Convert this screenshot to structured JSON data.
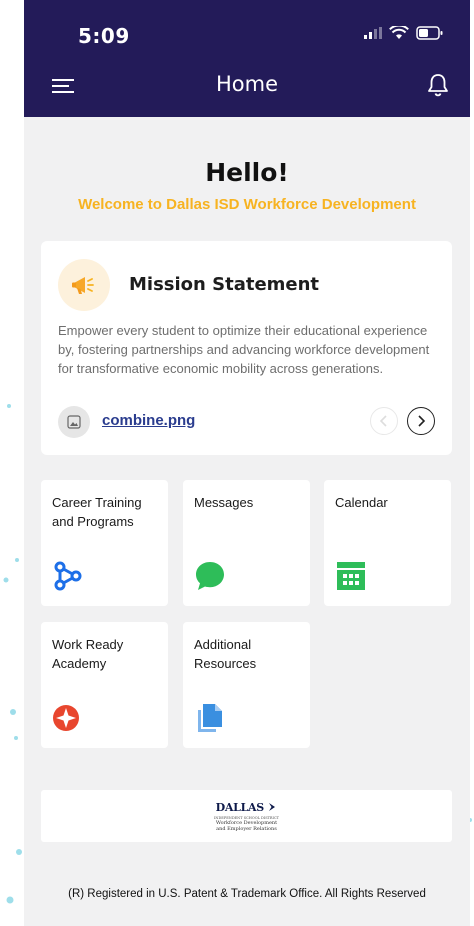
{
  "status_bar": {
    "time": "5:09"
  },
  "header": {
    "title": "Home"
  },
  "hero": {
    "greeting": "Hello!",
    "welcome": "Welcome to Dallas ISD Workforce Development"
  },
  "mission": {
    "title": "Mission Statement",
    "text": "Empower every student to optimize their educational experience by, fostering partnerships and advancing workforce development for transformative economic mobility across generations.",
    "attachment": "combine.png"
  },
  "tiles": [
    {
      "label": "Career Training and Programs",
      "icon": "network-icon",
      "color": "#1d6fe8"
    },
    {
      "label": "Messages",
      "icon": "chat-bubble-icon",
      "color": "#2ebd59"
    },
    {
      "label": "Calendar",
      "icon": "calendar-icon",
      "color": "#2ebd59"
    },
    {
      "label": "Work Ready Academy",
      "icon": "compass-star-icon",
      "color": "#e8462e"
    },
    {
      "label": "Additional Resources",
      "icon": "documents-icon",
      "color": "#3a8fe0"
    }
  ],
  "logo": {
    "main": "DALLAS",
    "tagline": "INDEPENDENT SCHOOL DISTRICT",
    "line1": "Workforce Development",
    "line2": "and Employer Relations"
  },
  "footer": {
    "text": "(R) Registered in U.S. Patent & Trademark Office. All Rights Reserved"
  },
  "colors": {
    "header_bg": "#231b59",
    "accent_yellow": "#f7b321",
    "page_bg": "#f1f1f2"
  }
}
